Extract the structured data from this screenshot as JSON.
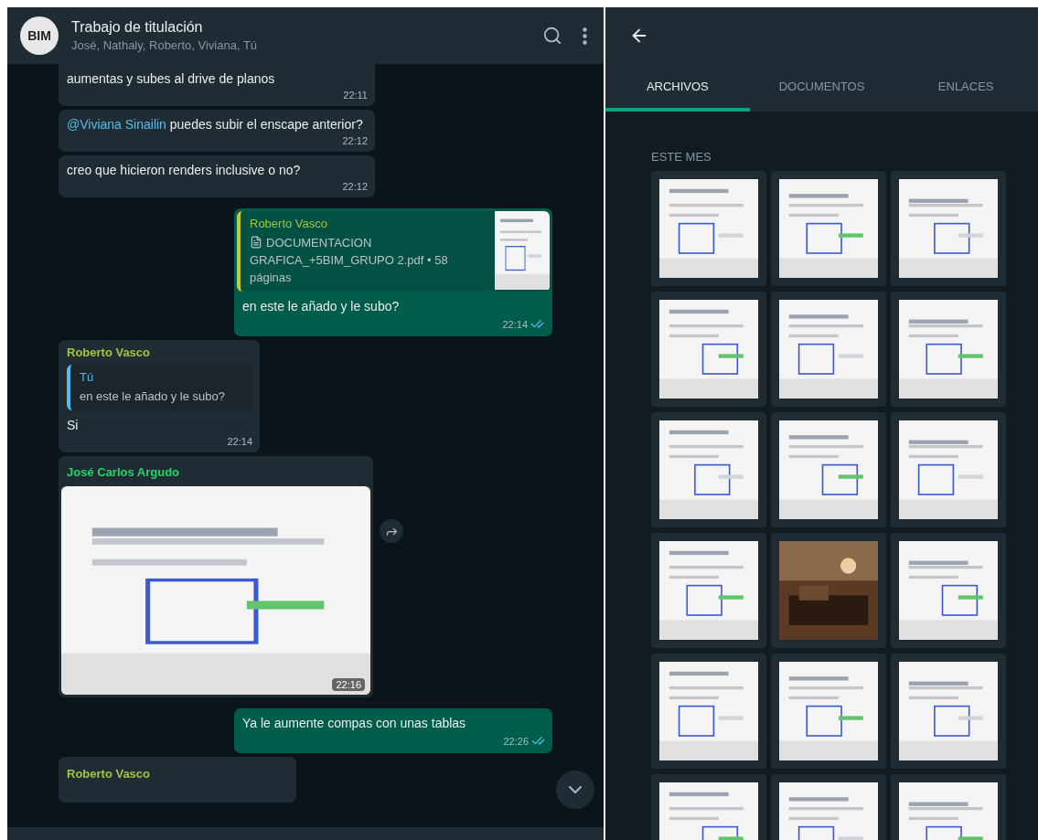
{
  "chat": {
    "title": "Trabajo de titulación",
    "members": "José, Nathaly, Roberto, Viviana, Tú",
    "avatar": "BIM",
    "messages": [
      {
        "kind": "text",
        "outgoing": false,
        "text": "aumentas y subes al drive de planos",
        "time": "22:11",
        "cut": true
      },
      {
        "kind": "text",
        "outgoing": false,
        "mention": "@Viviana Sinailin",
        "text": "puedes subir el enscape anterior?",
        "time": "22:12"
      },
      {
        "kind": "text",
        "outgoing": false,
        "text": "creo que hicieron renders inclusive o no?",
        "time": "22:12"
      },
      {
        "kind": "doc",
        "outgoing": true,
        "quote_author": "Roberto Vasco",
        "doc": "DOCUMENTACION GRAFICA_+5BIM_GRUPO 2.pdf • 58 páginas",
        "text": "en este le añado y le subo?",
        "time": "22:14",
        "read": true
      },
      {
        "kind": "reply",
        "outgoing": false,
        "author": "Roberto Vasco",
        "quote_author": "Tú",
        "quote": "en este le añado y le subo?",
        "text": "Si",
        "time": "22:14"
      },
      {
        "outgoing": false,
        "author": "José Carlos Argudo",
        "time": "22:16"
      },
      {
        "kind": "text",
        "outgoing": true,
        "text": "Ya le aumente compas con unas tablas",
        "time": "22:26",
        "read": true
      },
      {
        "kind": "partial",
        "outgoing": false,
        "author": "Roberto Vasco"
      }
    ]
  },
  "media": {
    "tabs": [
      {
        "label": "ARCHIVOS",
        "selected": true
      },
      {
        "label": "DOCUMENTOS",
        "selected": false
      },
      {
        "label": "ENLACES",
        "selected": false
      }
    ],
    "section": "ESTE MES"
  }
}
